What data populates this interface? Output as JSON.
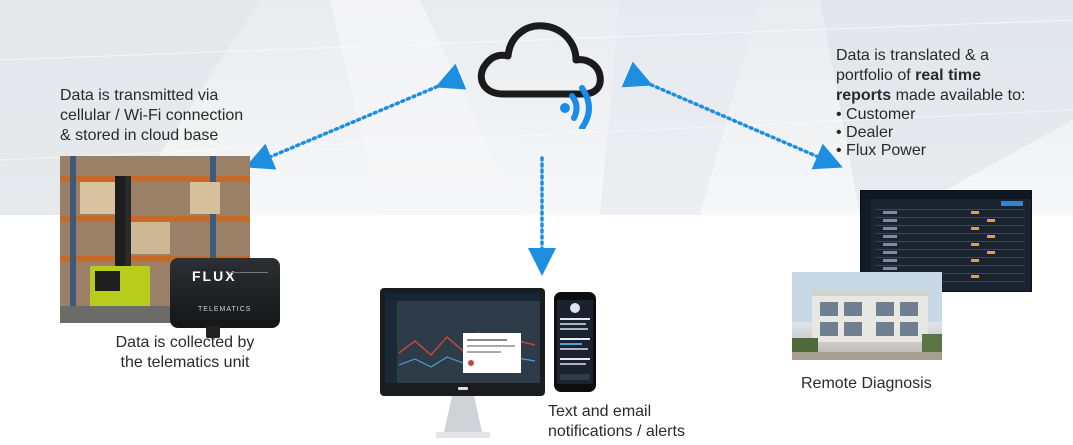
{
  "transmit_text": [
    "Data is transmitted via",
    "cellular / Wi-Fi connection",
    "& stored in cloud base"
  ],
  "translate_text": {
    "line1": "Data is translated & a",
    "line2_normal": "portfolio of ",
    "line2_bold": "real time",
    "line3_bold": "reports",
    "line3_normal": " made available to:",
    "recipients": [
      "Customer",
      "Dealer",
      "Flux Power"
    ]
  },
  "collected_text": [
    "Data is collected by",
    "the telematics unit"
  ],
  "alerts_text": [
    "Text and email",
    "notifications / alerts"
  ],
  "diagnosis_text": "Remote Diagnosis",
  "device_labels": {
    "telematics": "TELEMATICS",
    "flux": "FLUX"
  },
  "colors": {
    "arrow": "#1e8fe0",
    "cloud_stroke": "#1b1b1b",
    "signal": "#1b8be8"
  },
  "icons": [
    "cloud-icon",
    "wifi-signal-icon"
  ]
}
